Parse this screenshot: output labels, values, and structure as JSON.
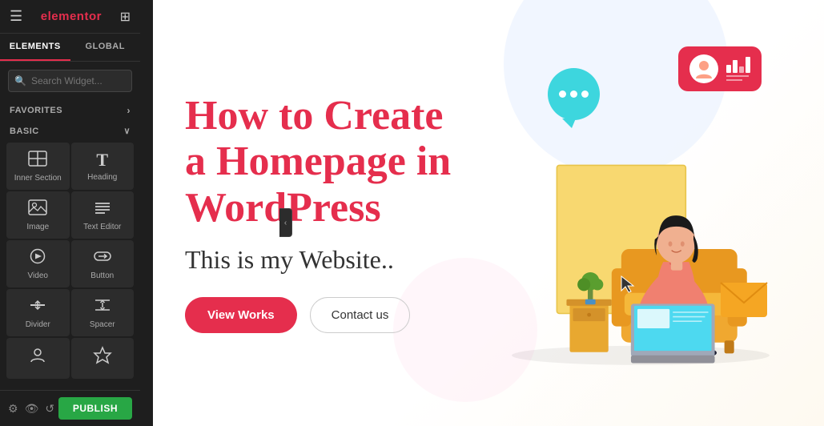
{
  "header": {
    "logo": "elementor",
    "hamburger": "≡",
    "grid_icon": "⊞"
  },
  "tabs": {
    "elements_label": "ELEMENTS",
    "global_label": "GLOBAL",
    "active": "elements"
  },
  "search": {
    "placeholder": "Search Widget..."
  },
  "favorites": {
    "label": "FAVORITES",
    "arrow": "›"
  },
  "basic": {
    "label": "BASIC",
    "arrow": "∨"
  },
  "widgets": [
    {
      "id": "inner-section",
      "label": "Inner Section",
      "icon": "▦"
    },
    {
      "id": "heading",
      "label": "Heading",
      "icon": "T"
    },
    {
      "id": "image",
      "label": "Image",
      "icon": "🖼"
    },
    {
      "id": "text-editor",
      "label": "Text Editor",
      "icon": "≡"
    },
    {
      "id": "video",
      "label": "Video",
      "icon": "▶"
    },
    {
      "id": "button",
      "label": "Button",
      "icon": "⬡"
    },
    {
      "id": "divider",
      "label": "Divider",
      "icon": "⊟"
    },
    {
      "id": "spacer",
      "label": "Spacer",
      "icon": "⇕"
    },
    {
      "id": "icon1",
      "label": "",
      "icon": "📍"
    },
    {
      "id": "icon2",
      "label": "",
      "icon": "★"
    }
  ],
  "footer": {
    "publish_label": "PUBLISH"
  },
  "preview": {
    "heading_line1": "How to Create",
    "heading_line2": "a Homepage in",
    "heading_line3": "WordPress",
    "subheading": "This is my Website..",
    "btn_primary": "View Works",
    "btn_secondary": "Contact us"
  },
  "colors": {
    "accent": "#e52e4d",
    "sidebar_bg": "#1e1e1e",
    "widget_bg": "#2c2c2c",
    "publish_green": "#28a745"
  }
}
